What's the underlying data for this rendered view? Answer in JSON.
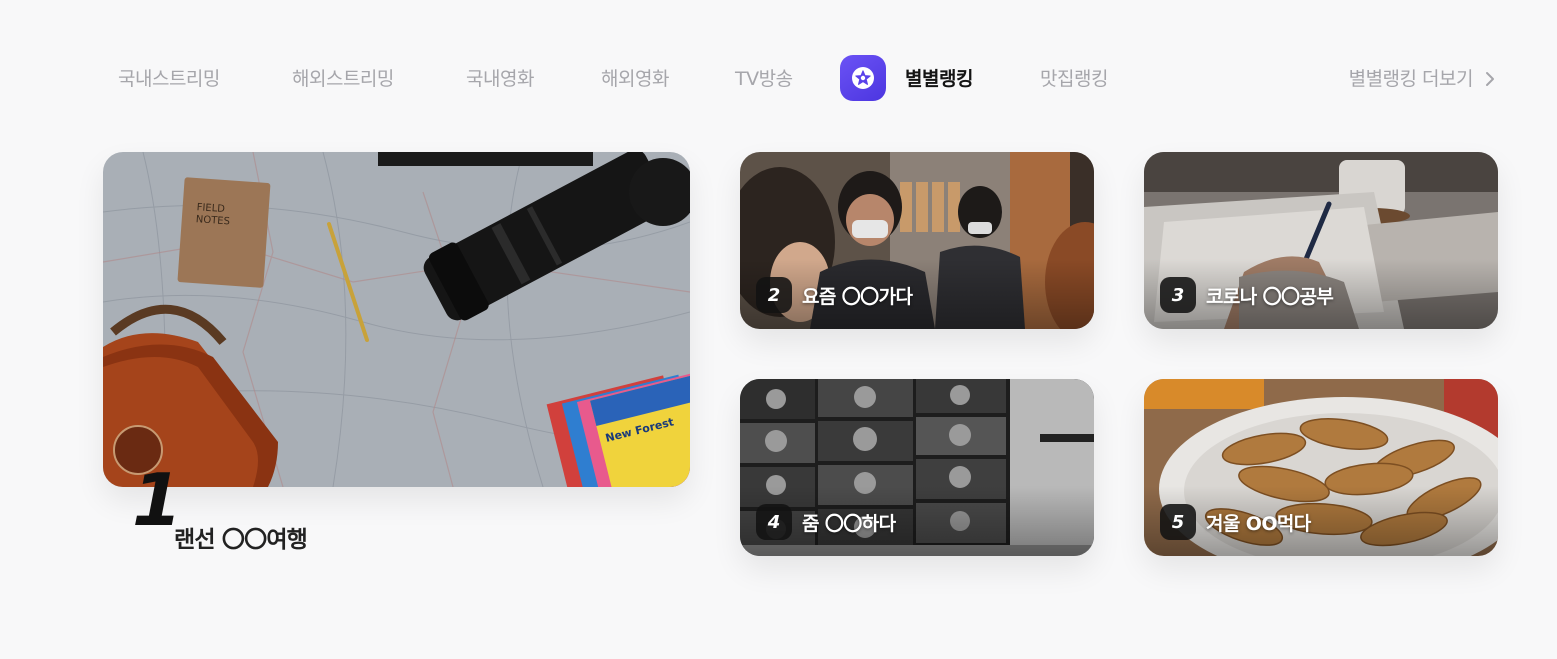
{
  "nav": {
    "tabs": [
      {
        "label": "국내스트리밍",
        "active": false
      },
      {
        "label": "해외스트리밍",
        "active": false
      },
      {
        "label": "국내영화",
        "active": false
      },
      {
        "label": "해외영화",
        "active": false
      },
      {
        "label": "TV방송",
        "active": false
      },
      {
        "label": "별별랭킹",
        "active": true,
        "icon": "star-badge-icon"
      },
      {
        "label": "맛집랭킹",
        "active": false
      }
    ],
    "more_label": "별별랭킹 더보기",
    "more_icon": "chevron-right-icon"
  },
  "ranking": [
    {
      "rank": "1",
      "title": "랜선 〇〇여행",
      "image": "travel-map-camera-photo"
    },
    {
      "rank": "2",
      "title": "요즘 〇〇가다",
      "image": "cafe-masked-people-photo"
    },
    {
      "rank": "3",
      "title": "코로나 〇〇공부",
      "image": "notebook-writing-photo"
    },
    {
      "rank": "4",
      "title": "줌 〇〇하다",
      "image": "video-call-laptop-photo"
    },
    {
      "rank": "5",
      "title": "겨울 OO먹다",
      "image": "fish-bread-plate-photo"
    }
  ],
  "colors": {
    "accent": "#5a42ea",
    "background": "#f8f8f9",
    "tab_inactive": "#a6a6ab",
    "tab_active": "#141414"
  }
}
